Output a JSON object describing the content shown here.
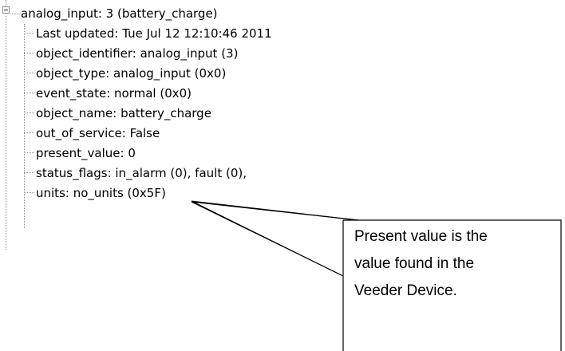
{
  "tree": {
    "root": {
      "label": "analog_input: 3  (battery_charge)",
      "expanded": true
    },
    "properties": [
      {
        "label": "Last updated: Tue Jul 12 12:10:46 2011"
      },
      {
        "label": "object_identifier: analog_input (3)"
      },
      {
        "label": "object_type: analog_input (0x0)"
      },
      {
        "label": "event_state: normal (0x0)"
      },
      {
        "label": "object_name: battery_charge"
      },
      {
        "label": "out_of_service: False"
      },
      {
        "label": "present_value: 0"
      },
      {
        "label": "status_flags: in_alarm (0), fault (0),"
      },
      {
        "label": "units: no_units (0x5F)"
      }
    ]
  },
  "callout": {
    "lines": [
      "Present value is the",
      "value found in the",
      "Veeder Device."
    ],
    "border_color": "#000000",
    "fill_color": "#ffffff"
  },
  "icons": {
    "expander": "minus-box-icon"
  }
}
